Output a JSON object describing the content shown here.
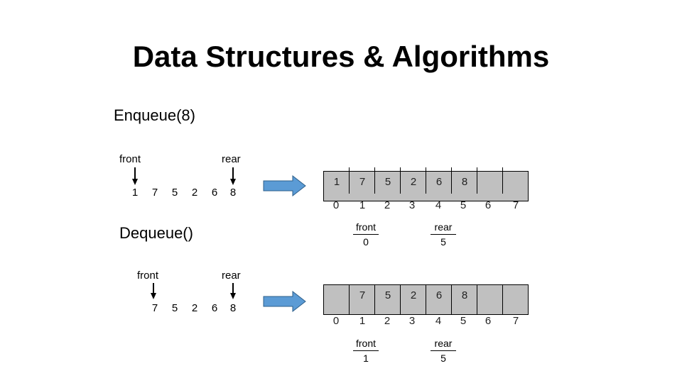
{
  "title": "Data Structures & Algorithms",
  "colors": {
    "array_fill": "#c0c0c0",
    "arrow_fill": "#5b9bd5",
    "arrow_stroke": "#2e5f8a"
  },
  "sections": [
    {
      "operation": "Enqueue(8)",
      "logical_queue": {
        "front_label": "front",
        "rear_label": "rear",
        "values": [
          "1",
          "7",
          "5",
          "2",
          "6",
          "8"
        ]
      },
      "array": {
        "cells": [
          "1",
          "7",
          "5",
          "2",
          "6",
          "8",
          "",
          ""
        ],
        "indices": [
          "0",
          "1",
          "2",
          "3",
          "4",
          "5",
          "6",
          "7"
        ]
      },
      "front": {
        "label": "front",
        "value": "0"
      },
      "rear": {
        "label": "rear",
        "value": "5"
      }
    },
    {
      "operation": "Dequeue()",
      "logical_queue": {
        "front_label": "front",
        "rear_label": "rear",
        "values": [
          "7",
          "5",
          "2",
          "6",
          "8"
        ]
      },
      "array": {
        "cells": [
          "",
          "7",
          "5",
          "2",
          "6",
          "8",
          "",
          ""
        ],
        "indices": [
          "0",
          "1",
          "2",
          "3",
          "4",
          "5",
          "6",
          "7"
        ]
      },
      "front": {
        "label": "front",
        "value": "1"
      },
      "rear": {
        "label": "rear",
        "value": "5"
      }
    }
  ]
}
